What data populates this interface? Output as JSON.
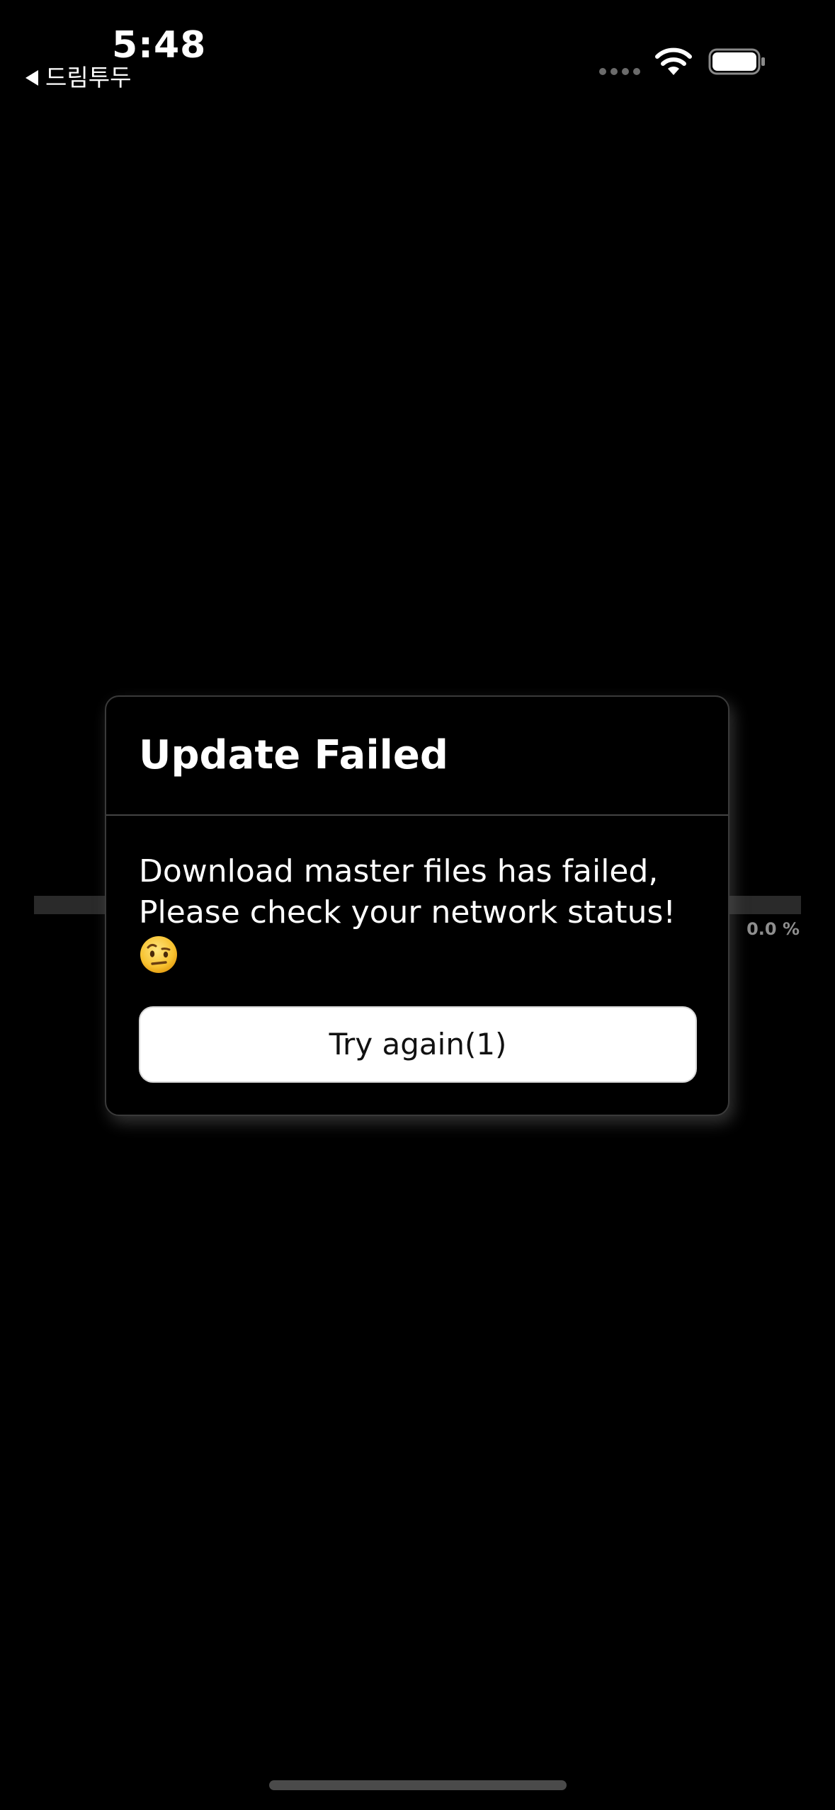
{
  "status_bar": {
    "time": "5:48",
    "back_app_label": "드림투두",
    "icons": [
      "wifi-icon",
      "battery-icon"
    ]
  },
  "progress": {
    "value_percent": 0.0,
    "label": "0.0 %"
  },
  "dialog": {
    "title": "Update Failed",
    "message": "Download master files has failed,\nPlease check your network status!",
    "emoji": "face-with-raised-eyebrow",
    "retry_button_label": "Try again(1)"
  },
  "colors": {
    "background": "#000000",
    "dialog_border": "#3a3a3a",
    "button_background": "#ffffff",
    "progress_track": "#2a2a2a",
    "progress_text": "#8e8e8e"
  }
}
